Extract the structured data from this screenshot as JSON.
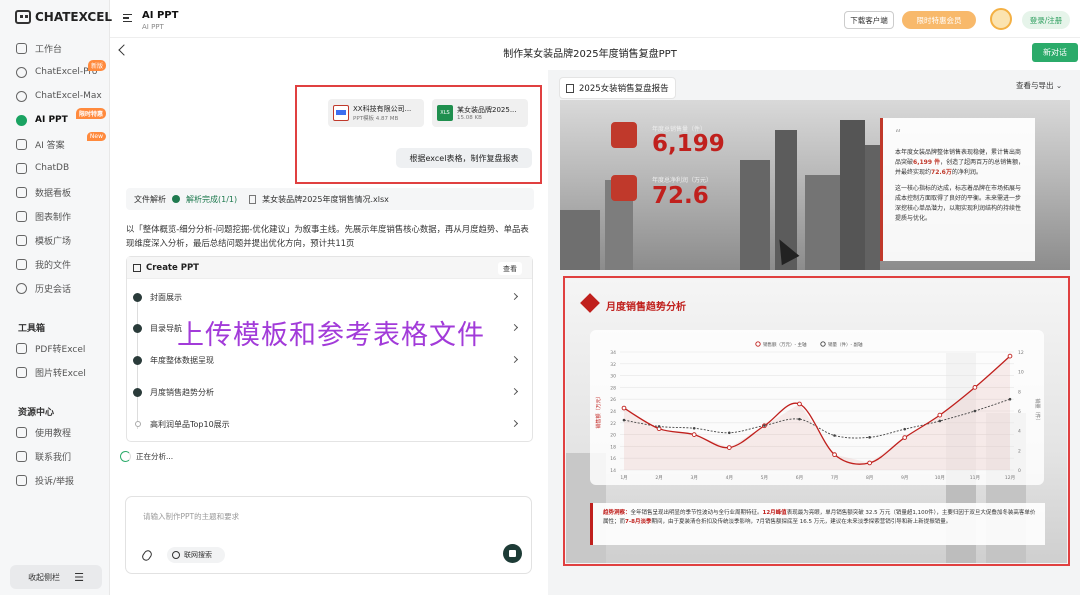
{
  "brand": {
    "name": "CHATEXCEL"
  },
  "sidebar": {
    "items": [
      {
        "label": "工作台"
      },
      {
        "label": "ChatExcel-Pro",
        "badge": "新版"
      },
      {
        "label": "ChatExcel-Max"
      },
      {
        "label": "AI PPT",
        "badge": "限时特惠"
      },
      {
        "label": "AI 答案",
        "badge": "New"
      },
      {
        "label": "ChatDB"
      },
      {
        "label": "数据看板"
      },
      {
        "label": "图表制作"
      },
      {
        "label": "模板广场"
      },
      {
        "label": "我的文件"
      },
      {
        "label": "历史会话"
      }
    ],
    "tools_title": "工具箱",
    "tools": [
      {
        "label": "PDF转Excel"
      },
      {
        "label": "图片转Excel"
      }
    ],
    "resources_title": "资源中心",
    "resources": [
      {
        "label": "使用教程"
      },
      {
        "label": "联系我们"
      },
      {
        "label": "投诉/举报"
      }
    ],
    "collapse_label": "收起侧栏"
  },
  "topbar": {
    "title": "AI PPT",
    "subtitle": "AI PPT",
    "download_label": "下载客户端",
    "vip_label": "限时特惠会员",
    "register_label": "登录/注册"
  },
  "header": {
    "page_title": "制作某女装品牌2025年度销售复盘PPT",
    "new_chat_label": "新对话"
  },
  "chat": {
    "files": [
      {
        "name": "XX科技有限公司...",
        "meta": "PPT模板 4.87 MB",
        "type": "ppt"
      },
      {
        "name": "某女装品牌2025...",
        "meta": "15.08 KB",
        "type": "xls",
        "type_label": "XLS"
      }
    ],
    "prompt": "根据excel表格，制作复盘报表",
    "parse": {
      "label": "文件解析",
      "status": "解析完成(1/1)",
      "file": "某女装品牌2025年度销售情况.xlsx"
    },
    "description": "以「整体概览-细分分析-问题挖掘-优化建议」为叙事主线。先展示年度销售核心数据，再从月度趋势、单品表现维度深入分析，最后总结问题并提出优化方向，预计共11页",
    "create": {
      "title": "Create PPT",
      "view_label": "查看",
      "steps": [
        {
          "label": "封面展示",
          "done": true
        },
        {
          "label": "目录导航",
          "done": true
        },
        {
          "label": "年度整体数据呈现",
          "done": true
        },
        {
          "label": "月度销售趋势分析",
          "done": true
        },
        {
          "label": "高利润单品Top10展示",
          "done": false
        }
      ]
    },
    "analyzing_label": "正在分析...",
    "overlay_caption": "上传模板和参考表格文件",
    "input_placeholder": "请输入制作PPT的主题和要求",
    "web_search_label": "联网搜索"
  },
  "preview": {
    "report_tag": "2025女装销售复盘报告",
    "view_export_label": "查看与导出",
    "slide1": {
      "stat1_label": "年度总销售量（件）",
      "stat1_value": "6,199",
      "stat2_label": "年度总净利润（万元）",
      "stat2_value": "72.6",
      "quote_mark": "“",
      "para1_a": "本年度女装品牌整体销售表现稳健，累计售出商品突破",
      "para1_hl1": "6,199 件",
      "para1_b": "，创造了超两百万的总销售额，并最终实现约",
      "para1_hl2": "72.6万",
      "para1_c": "的净利润。",
      "para2": "这一核心指标的达成，标志着品牌在市场拓展与成本控制方面取得了良好的平衡。未来需进一步深挖核心单品潜力，以期实现利润结构的持续性提质与优化。"
    },
    "slide2": {
      "title": "月度销售趋势分析",
      "note_label": "趋势洞察：",
      "note_a": "全年销售呈现出明显的季节性波动与全行业周期特征。",
      "note_hl": "12月峰值",
      "note_b": "表现最为亮眼，单月销售额突破 32.5 万元（销量超1,100件），主要归因于双旦大促叠加冬装高客单价属性；而",
      "note_hl2": "7-8月淡季",
      "note_c": "期间，由于夏装清仓折扣及传统淡季影响，7月销售额探底至 16.5 万元，建议在未来淡季探索营销引导和新上新提振销量。"
    }
  },
  "colors": {
    "accent_green": "#2bab6a",
    "brand_red": "#c0201d",
    "highlight_frame": "#e04040",
    "caption_purple": "#a23bd9"
  },
  "chart_data": {
    "type": "line",
    "categories": [
      "1月",
      "2月",
      "3月",
      "4月",
      "5月",
      "6月",
      "7月",
      "8月",
      "9月",
      "10月",
      "11月",
      "12月"
    ],
    "series": [
      {
        "name": "销售额（万元）- 主轴",
        "values": [
          24.5,
          21,
          20,
          17.8,
          21.5,
          25.2,
          16.6,
          15.2,
          19.5,
          23.3,
          28,
          33.3
        ]
      },
      {
        "name": "销量（件）- 副轴",
        "values": [
          550,
          480,
          460,
          410,
          490,
          560,
          380,
          360,
          450,
          540,
          650,
          780
        ]
      }
    ],
    "y_ticks": [
      "14",
      "16",
      "18",
      "20",
      "22",
      "24",
      "26",
      "28",
      "30",
      "32",
      "34"
    ],
    "y2_ticks": [
      "0",
      "2",
      "4",
      "6",
      "8",
      "10",
      "12"
    ],
    "ylim": [
      14,
      34
    ],
    "y2lim": [
      0,
      1300
    ],
    "ylabel": "销售额（万元）",
    "y2label": "销量（件）",
    "legend_position": "top-center",
    "grid": true
  }
}
